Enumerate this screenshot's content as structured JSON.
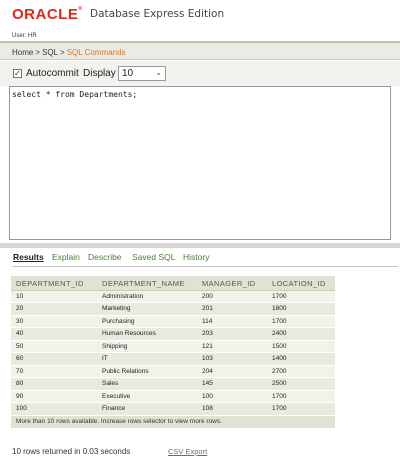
{
  "header": {
    "logo_text": "ORACLE",
    "logo_mark": "®",
    "product": "Database Express Edition",
    "user": "User: HR"
  },
  "breadcrumb": {
    "items": [
      "Home",
      "SQL",
      "SQL Commands"
    ],
    "separator": ">"
  },
  "toolbar": {
    "autocommit_label": "Autocommit",
    "autocommit_checked": true,
    "display_label": "Display",
    "display_value": "10"
  },
  "editor": {
    "sql": "select * from Departments;"
  },
  "tabs": [
    {
      "label": "Results",
      "active": true
    },
    {
      "label": "Explain",
      "active": false
    },
    {
      "label": "Describe",
      "active": false
    },
    {
      "label": "Saved SQL",
      "active": false
    },
    {
      "label": "History",
      "active": false
    }
  ],
  "results": {
    "columns": [
      "DEPARTMENT_ID",
      "DEPARTMENT_NAME",
      "MANAGER_ID",
      "LOCATION_ID"
    ],
    "rows": [
      [
        "10",
        "Administration",
        "200",
        "1700"
      ],
      [
        "20",
        "Marketing",
        "201",
        "1800"
      ],
      [
        "30",
        "Purchasing",
        "114",
        "1700"
      ],
      [
        "40",
        "Human Resources",
        "203",
        "2400"
      ],
      [
        "50",
        "Shipping",
        "121",
        "1500"
      ],
      [
        "60",
        "IT",
        "103",
        "1400"
      ],
      [
        "70",
        "Public Relations",
        "204",
        "2700"
      ],
      [
        "80",
        "Sales",
        "145",
        "2500"
      ],
      [
        "90",
        "Executive",
        "100",
        "1700"
      ],
      [
        "100",
        "Finance",
        "108",
        "1700"
      ]
    ],
    "more_rows_note": "More than 10 rows available. Increase rows selector to view more rows."
  },
  "footer": {
    "status": "10 rows returned in 0.03 seconds",
    "csv_export": "CSV Export"
  },
  "colors": {
    "brand_red": "#e3261c",
    "breadcrumb_current": "#e0751f",
    "tab_link": "#4a7d3a",
    "table_header": "#e0e3d4"
  }
}
